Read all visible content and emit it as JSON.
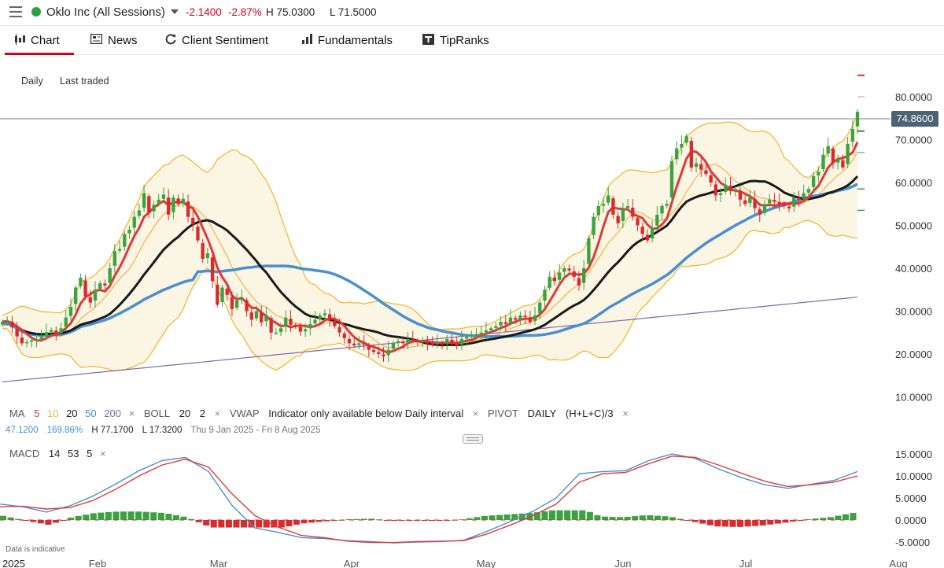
{
  "header": {
    "instrument": "Oklo Inc (All Sessions)",
    "change": "-2.1400",
    "change_pct": "-2.87%",
    "high": "H 75.0300",
    "low": "L 71.5000",
    "status_color": "#2ea043",
    "neg_color": "#d0021b"
  },
  "tabs": [
    {
      "label": "Chart",
      "icon": "candlestick-icon",
      "active": true
    },
    {
      "label": "News",
      "icon": "newspaper-icon"
    },
    {
      "label": "Client Sentiment",
      "icon": "refresh-icon"
    },
    {
      "label": "Fundamentals",
      "icon": "bar-chart-icon"
    },
    {
      "label": "TipRanks",
      "icon": "tipranks-icon"
    }
  ],
  "chart_controls": {
    "interval": "Daily",
    "price_type": "Last traded"
  },
  "price_badge": "74.8600",
  "legend": {
    "ma_label": "MA",
    "ma_periods": [
      "5",
      "10",
      "20",
      "50",
      "200"
    ],
    "boll_label": "BOLL",
    "boll_period": "20",
    "boll_dev": "2",
    "vwap_label": "VWAP",
    "vwap_note": "Indicator only available below Daily interval",
    "pivot_label": "PIVOT",
    "pivot_period": "DAILY",
    "pivot_formula": "(H+L+C)/3",
    "range_change": "47.1200",
    "range_change_pct": "169.86%",
    "range_high": "H 77.1700",
    "range_low": "L 17.3200",
    "range_dates": "Thu 9 Jan 2025 - Fri 8 Aug 2025",
    "macd_label": "MACD",
    "macd_params": [
      "14",
      "53",
      "5"
    ],
    "close_glyph": "×"
  },
  "footer_note": "Data is indicative",
  "colors": {
    "up": "#3aa341",
    "down": "#d92b2b",
    "ma5": "#e0393a",
    "ma10": "#f2b24a",
    "ma20": "#1a1a1a",
    "ma50": "#4a8fd0",
    "ma200": "#7b6aa8",
    "boll": "#f0b429",
    "boll_fill": "#fbf5e3",
    "macd": "#4a8fd0",
    "signal": "#e0393a"
  },
  "chart_data": [
    {
      "type": "candlestick",
      "ylim": [
        5,
        90
      ],
      "y_ticks": [
        "10.0000",
        "20.0000",
        "30.0000",
        "40.0000",
        "50.0000",
        "60.0000",
        "70.0000",
        "80.0000"
      ],
      "x_ticks": [
        "2025",
        "Feb",
        "Mar",
        "Apr",
        "May",
        "Jun",
        "Jul",
        "Aug"
      ],
      "last_price": 74.86,
      "close_series": [
        27.5,
        27.8,
        26.2,
        24.1,
        22.5,
        22.8,
        23.2,
        23.4,
        24.0,
        25.1,
        25.6,
        24.8,
        26.0,
        28.5,
        31.0,
        35.5,
        37.8,
        33.5,
        32.0,
        35.0,
        36.5,
        36.0,
        40.0,
        44.0,
        44.5,
        48.0,
        49.0,
        52.0,
        53.5,
        57.5,
        53.0,
        54.8,
        56.0,
        57.2,
        52.5,
        56.5,
        55.0,
        56.2,
        52.0,
        50.3,
        46.5,
        42.2,
        43.5,
        37.0,
        31.5,
        35.5,
        33.8,
        30.5,
        32.5,
        33.0,
        30.0,
        28.0,
        30.0,
        27.4,
        29.0,
        25.0,
        25.0,
        26.0,
        28.5,
        26.8,
        26.5,
        25.2,
        25.8,
        27.0,
        28.0,
        29.0,
        29.5,
        28.0,
        26.5,
        25.0,
        23.7,
        22.5,
        22.0,
        22.5,
        22.2,
        21.0,
        20.5,
        20.0,
        19.5,
        21.0,
        22.5,
        23.0,
        22.5,
        23.5,
        23.2,
        22.8,
        23.0,
        22.5,
        22.3,
        22.6,
        22.4,
        23.5,
        22.5,
        22.0,
        23.5,
        24.0,
        24.5,
        24.7,
        25.0,
        25.5,
        26.0,
        26.5,
        27.5,
        27.0,
        28.5,
        28.0,
        29.0,
        28.6,
        27.5,
        29.0,
        32.0,
        35.0,
        38.0,
        37.0,
        39.0,
        40.0,
        39.5,
        38.0,
        36.0,
        40.0,
        47.0,
        52.0,
        54.5,
        55.0,
        57.0,
        52.5,
        50.5,
        54.0,
        54.5,
        52.0,
        50.0,
        48.0,
        46.5,
        49.5,
        52.5,
        54.5,
        55.0,
        65.0,
        68.0,
        69.0,
        70.8,
        63.5,
        64.5,
        63.0,
        62.0,
        60.0,
        57.0,
        57.5,
        59.5,
        58.0,
        58.5,
        56.0,
        55.0,
        56.5,
        54.0,
        52.5,
        55.0,
        56.0,
        55.5,
        55.0,
        54.5,
        54.0,
        56.5,
        56.0,
        57.5,
        58.5,
        61.5,
        62.5,
        66.5,
        68.5,
        64.5,
        65.5,
        63.5,
        69.0,
        72.5,
        76.5
      ]
    },
    {
      "type": "line",
      "title": "MACD",
      "ylim": [
        -5,
        15
      ],
      "y_ticks": [
        "-5.0000",
        "0.0000",
        "5.0000",
        "10.0000",
        "15.0000"
      ],
      "series": [
        {
          "name": "MACD",
          "values": [
            3.6,
            3.0,
            1.8,
            3.2,
            5.4,
            8.2,
            11.2,
            13.5,
            14.2,
            11.0,
            3.4,
            -1.8,
            -2.8,
            -4.0,
            -4.2,
            -4.7,
            -4.9,
            -5.2,
            -5.0,
            -4.9,
            -4.6,
            -2.6,
            -0.4,
            2.0,
            5.0,
            10.5,
            11.0,
            11.2,
            13.5,
            15.0,
            14.0,
            11.6,
            9.6,
            8.0,
            7.2,
            8.1,
            9.0,
            11.0
          ]
        },
        {
          "name": "Signal",
          "values": [
            3.0,
            3.1,
            2.5,
            2.8,
            4.4,
            7.0,
            10.0,
            12.5,
            13.8,
            12.0,
            6.0,
            1.0,
            -1.6,
            -3.5,
            -4.0,
            -4.8,
            -5.1,
            -5.1,
            -4.9,
            -4.8,
            -4.7,
            -3.2,
            -1.2,
            1.0,
            3.6,
            8.6,
            10.5,
            10.8,
            12.8,
            14.5,
            14.2,
            12.5,
            10.6,
            8.8,
            7.6,
            8.0,
            8.6,
            10.0
          ]
        }
      ]
    }
  ]
}
